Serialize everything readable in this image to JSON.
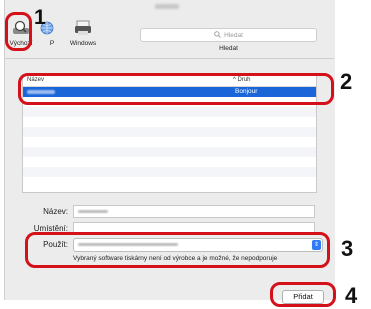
{
  "toolbar": {
    "default_label": "Výchozí",
    "ip_label": "P",
    "windows_label": "Windows"
  },
  "search": {
    "placeholder": "Hledat",
    "caption": "Hledat"
  },
  "list": {
    "columns": [
      "Název",
      "Druh"
    ],
    "rows": [
      {
        "name": "",
        "kind": "Bonjour",
        "selected": true
      }
    ]
  },
  "fields": {
    "name_label": "Název:",
    "location_label": "Umístění:",
    "use_label": "Použít:"
  },
  "driver_note": "Vybraný software tiskárny není od výrobce a je možné, že nepodporuje",
  "add_button": "Přidat",
  "callouts": [
    "1",
    "2",
    "3",
    "4"
  ],
  "colors": {
    "callout": "#d4101a",
    "selection": "#1a66d9"
  }
}
